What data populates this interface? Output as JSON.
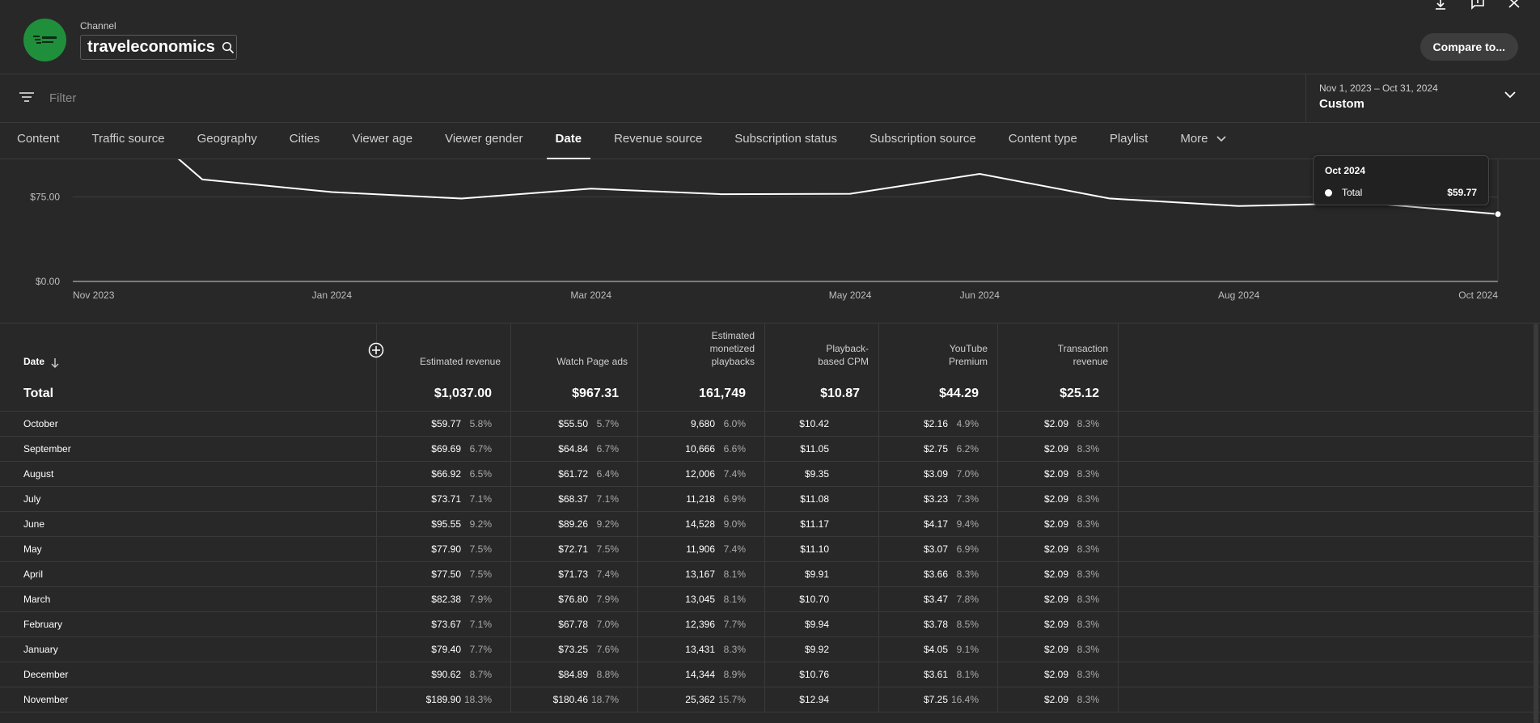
{
  "header": {
    "channel_label": "Channel",
    "channel_name": "traveleconomics",
    "compare_button": "Compare to..."
  },
  "filter": {
    "placeholder": "Filter",
    "date_range": "Nov 1, 2023 – Oct 31, 2024",
    "preset": "Custom"
  },
  "tabs": [
    {
      "label": "Content"
    },
    {
      "label": "Traffic source"
    },
    {
      "label": "Geography"
    },
    {
      "label": "Cities"
    },
    {
      "label": "Viewer age"
    },
    {
      "label": "Viewer gender"
    },
    {
      "label": "Date"
    },
    {
      "label": "Revenue source"
    },
    {
      "label": "Subscription status"
    },
    {
      "label": "Subscription source"
    },
    {
      "label": "Content type"
    },
    {
      "label": "Playlist"
    },
    {
      "label": "More"
    }
  ],
  "chart_data": {
    "type": "line",
    "x": [
      "Nov 2023",
      "Dec 2023",
      "Jan 2024",
      "Feb 2024",
      "Mar 2024",
      "Apr 2024",
      "May 2024",
      "Jun 2024",
      "Jul 2024",
      "Aug 2024",
      "Sep 2024",
      "Oct 2024"
    ],
    "series": [
      {
        "name": "Total",
        "values": [
          189.9,
          90.62,
          79.4,
          73.67,
          82.38,
          77.5,
          77.9,
          95.55,
          73.71,
          66.92,
          69.69,
          59.77
        ]
      }
    ],
    "x_tick_labels": [
      "Nov 2023",
      "Jan 2024",
      "Mar 2024",
      "May 2024",
      "Jun 2024",
      "Aug 2024",
      "Oct 2024"
    ],
    "y_tick_labels": [
      "$75.00",
      "$0.00"
    ],
    "ylim": [
      0,
      100
    ],
    "grid": true
  },
  "tooltip": {
    "title": "Oct 2024",
    "series_name": "Total",
    "value": "$59.77"
  },
  "table": {
    "headers": [
      [
        "Date"
      ],
      [
        "Estimated revenue"
      ],
      [
        "Watch Page ads"
      ],
      [
        "Estimated",
        "monetized",
        "playbacks"
      ],
      [
        "Playback-",
        "based CPM"
      ],
      [
        "YouTube",
        "Premium"
      ],
      [
        "Transaction",
        "revenue"
      ]
    ],
    "total": {
      "label": "Total",
      "values": [
        "$1,037.00",
        "$967.31",
        "161,749",
        "$10.87",
        "$44.29",
        "$25.12"
      ]
    },
    "rows": [
      {
        "label": "October",
        "cells": [
          [
            "$59.77",
            "5.8%"
          ],
          [
            "$55.50",
            "5.7%"
          ],
          [
            "9,680",
            "6.0%"
          ],
          [
            "$10.42",
            ""
          ],
          [
            "$2.16",
            "4.9%"
          ],
          [
            "$2.09",
            "8.3%"
          ]
        ]
      },
      {
        "label": "September",
        "cells": [
          [
            "$69.69",
            "6.7%"
          ],
          [
            "$64.84",
            "6.7%"
          ],
          [
            "10,666",
            "6.6%"
          ],
          [
            "$11.05",
            ""
          ],
          [
            "$2.75",
            "6.2%"
          ],
          [
            "$2.09",
            "8.3%"
          ]
        ]
      },
      {
        "label": "August",
        "cells": [
          [
            "$66.92",
            "6.5%"
          ],
          [
            "$61.72",
            "6.4%"
          ],
          [
            "12,006",
            "7.4%"
          ],
          [
            "$9.35",
            ""
          ],
          [
            "$3.09",
            "7.0%"
          ],
          [
            "$2.09",
            "8.3%"
          ]
        ]
      },
      {
        "label": "July",
        "cells": [
          [
            "$73.71",
            "7.1%"
          ],
          [
            "$68.37",
            "7.1%"
          ],
          [
            "11,218",
            "6.9%"
          ],
          [
            "$11.08",
            ""
          ],
          [
            "$3.23",
            "7.3%"
          ],
          [
            "$2.09",
            "8.3%"
          ]
        ]
      },
      {
        "label": "June",
        "cells": [
          [
            "$95.55",
            "9.2%"
          ],
          [
            "$89.26",
            "9.2%"
          ],
          [
            "14,528",
            "9.0%"
          ],
          [
            "$11.17",
            ""
          ],
          [
            "$4.17",
            "9.4%"
          ],
          [
            "$2.09",
            "8.3%"
          ]
        ]
      },
      {
        "label": "May",
        "cells": [
          [
            "$77.90",
            "7.5%"
          ],
          [
            "$72.71",
            "7.5%"
          ],
          [
            "11,906",
            "7.4%"
          ],
          [
            "$11.10",
            ""
          ],
          [
            "$3.07",
            "6.9%"
          ],
          [
            "$2.09",
            "8.3%"
          ]
        ]
      },
      {
        "label": "April",
        "cells": [
          [
            "$77.50",
            "7.5%"
          ],
          [
            "$71.73",
            "7.4%"
          ],
          [
            "13,167",
            "8.1%"
          ],
          [
            "$9.91",
            ""
          ],
          [
            "$3.66",
            "8.3%"
          ],
          [
            "$2.09",
            "8.3%"
          ]
        ]
      },
      {
        "label": "March",
        "cells": [
          [
            "$82.38",
            "7.9%"
          ],
          [
            "$76.80",
            "7.9%"
          ],
          [
            "13,045",
            "8.1%"
          ],
          [
            "$10.70",
            ""
          ],
          [
            "$3.47",
            "7.8%"
          ],
          [
            "$2.09",
            "8.3%"
          ]
        ]
      },
      {
        "label": "February",
        "cells": [
          [
            "$73.67",
            "7.1%"
          ],
          [
            "$67.78",
            "7.0%"
          ],
          [
            "12,396",
            "7.7%"
          ],
          [
            "$9.94",
            ""
          ],
          [
            "$3.78",
            "8.5%"
          ],
          [
            "$2.09",
            "8.3%"
          ]
        ]
      },
      {
        "label": "January",
        "cells": [
          [
            "$79.40",
            "7.7%"
          ],
          [
            "$73.25",
            "7.6%"
          ],
          [
            "13,431",
            "8.3%"
          ],
          [
            "$9.92",
            ""
          ],
          [
            "$4.05",
            "9.1%"
          ],
          [
            "$2.09",
            "8.3%"
          ]
        ]
      },
      {
        "label": "December",
        "cells": [
          [
            "$90.62",
            "8.7%"
          ],
          [
            "$84.89",
            "8.8%"
          ],
          [
            "14,344",
            "8.9%"
          ],
          [
            "$10.76",
            ""
          ],
          [
            "$3.61",
            "8.1%"
          ],
          [
            "$2.09",
            "8.3%"
          ]
        ]
      },
      {
        "label": "November",
        "cells": [
          [
            "$189.90",
            "18.3%"
          ],
          [
            "$180.46",
            "18.7%"
          ],
          [
            "25,362",
            "15.7%"
          ],
          [
            "$12.94",
            ""
          ],
          [
            "$7.25",
            "16.4%"
          ],
          [
            "$2.09",
            "8.3%"
          ]
        ]
      }
    ]
  },
  "icons": {
    "search": "search-icon",
    "filter": "filter-icon",
    "chevron": "chevron-down-icon",
    "download": "download-icon",
    "feedback": "feedback-icon",
    "close": "close-icon",
    "sort": "arrow-down-icon",
    "add_column": "add-circle-icon"
  },
  "colors": {
    "background": "#282828",
    "logo_green": "#1f8f3b",
    "line": "#ffffff"
  }
}
